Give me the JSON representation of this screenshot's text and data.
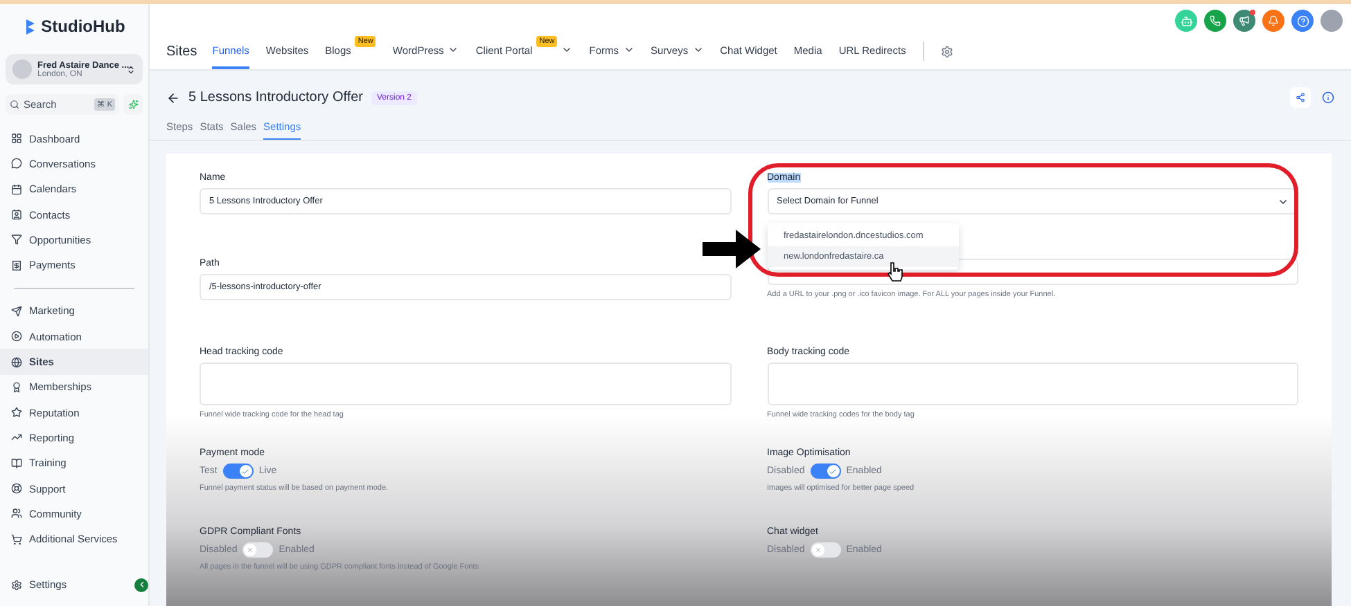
{
  "sidebar": {
    "brand": "StudioHub",
    "account": {
      "name": "Fred Astaire Dance ...",
      "location": "London, ON"
    },
    "search": {
      "placeholder": "Search",
      "shortcut": "⌘ K"
    },
    "items": [
      {
        "label": "Dashboard",
        "selected": false
      },
      {
        "label": "Conversations",
        "selected": false
      },
      {
        "label": "Calendars",
        "selected": false
      },
      {
        "label": "Contacts",
        "selected": false
      },
      {
        "label": "Opportunities",
        "selected": false
      },
      {
        "label": "Payments",
        "selected": false
      },
      {
        "label": "Marketing",
        "selected": false
      },
      {
        "label": "Automation",
        "selected": false
      },
      {
        "label": "Sites",
        "selected": true
      },
      {
        "label": "Memberships",
        "selected": false
      },
      {
        "label": "Reputation",
        "selected": false
      },
      {
        "label": "Reporting",
        "selected": false
      },
      {
        "label": "Training",
        "selected": false
      },
      {
        "label": "Support",
        "selected": false
      },
      {
        "label": "Community",
        "selected": false
      },
      {
        "label": "Additional Services",
        "selected": false
      }
    ],
    "footer": {
      "label": "Settings"
    }
  },
  "topnav": {
    "title": "Sites",
    "items": [
      {
        "label": "Funnels",
        "selected": true,
        "dropdown": false
      },
      {
        "label": "Websites",
        "selected": false,
        "dropdown": false
      },
      {
        "label": "Blogs",
        "selected": false,
        "dropdown": false,
        "badge": "New"
      },
      {
        "label": "WordPress",
        "selected": false,
        "dropdown": true
      },
      {
        "label": "Client Portal",
        "selected": false,
        "dropdown": true,
        "badge": "New"
      },
      {
        "label": "Forms",
        "selected": false,
        "dropdown": true
      },
      {
        "label": "Surveys",
        "selected": false,
        "dropdown": true
      },
      {
        "label": "Chat Widget",
        "selected": false,
        "dropdown": false
      },
      {
        "label": "Media",
        "selected": false,
        "dropdown": false
      },
      {
        "label": "URL Redirects",
        "selected": false,
        "dropdown": false
      }
    ]
  },
  "header": {
    "title": "5 Lessons Introductory Offer",
    "version": "Version 2"
  },
  "tabs": [
    {
      "label": "Steps",
      "selected": false
    },
    {
      "label": "Stats",
      "selected": false
    },
    {
      "label": "Sales",
      "selected": false
    },
    {
      "label": "Settings",
      "selected": true
    }
  ],
  "settings": {
    "left": [
      {
        "kind": "input",
        "label": "Name",
        "value": "5 Lessons Introductory Offer"
      },
      {
        "kind": "input",
        "label": "Path",
        "value": "/5-lessons-introductory-offer"
      },
      {
        "kind": "textarea",
        "label": "Head tracking code",
        "help": "Funnel wide tracking code for the head tag"
      },
      {
        "kind": "toggle",
        "label": "Payment mode",
        "off_label": "Test",
        "on_label": "Live",
        "on": true,
        "help": "Funnel payment status will be based on payment mode."
      },
      {
        "kind": "toggle",
        "label": "GDPR Compliant Fonts",
        "off_label": "Disabled",
        "on_label": "Enabled",
        "on": false,
        "help": "All pages in the funnel will be using GDPR compliant fonts instead of Google Fonts"
      }
    ],
    "right": [
      {
        "kind": "select",
        "label": "Domain",
        "label_highlighted": true,
        "value": "Select Domain for Funnel",
        "options": [
          {
            "label": "fredastairelondon.dncestudios.com",
            "selected": false
          },
          {
            "label": "new.londonfredastaire.ca",
            "selected": true
          }
        ]
      },
      {
        "kind": "input",
        "help": "Add a URL to your .png or .ico favicon image. For ALL your pages inside your Funnel."
      },
      {
        "kind": "textarea",
        "label": "Body tracking code",
        "help": "Funnel wide tracking codes for the body tag"
      },
      {
        "kind": "toggle",
        "label": "Image Optimisation",
        "off_label": "Disabled",
        "on_label": "Enabled",
        "on": true,
        "help": "Images will optimised for better page speed"
      },
      {
        "kind": "toggle",
        "label": "Chat widget",
        "off_label": "Disabled",
        "on_label": "Enabled",
        "on": false
      }
    ]
  }
}
